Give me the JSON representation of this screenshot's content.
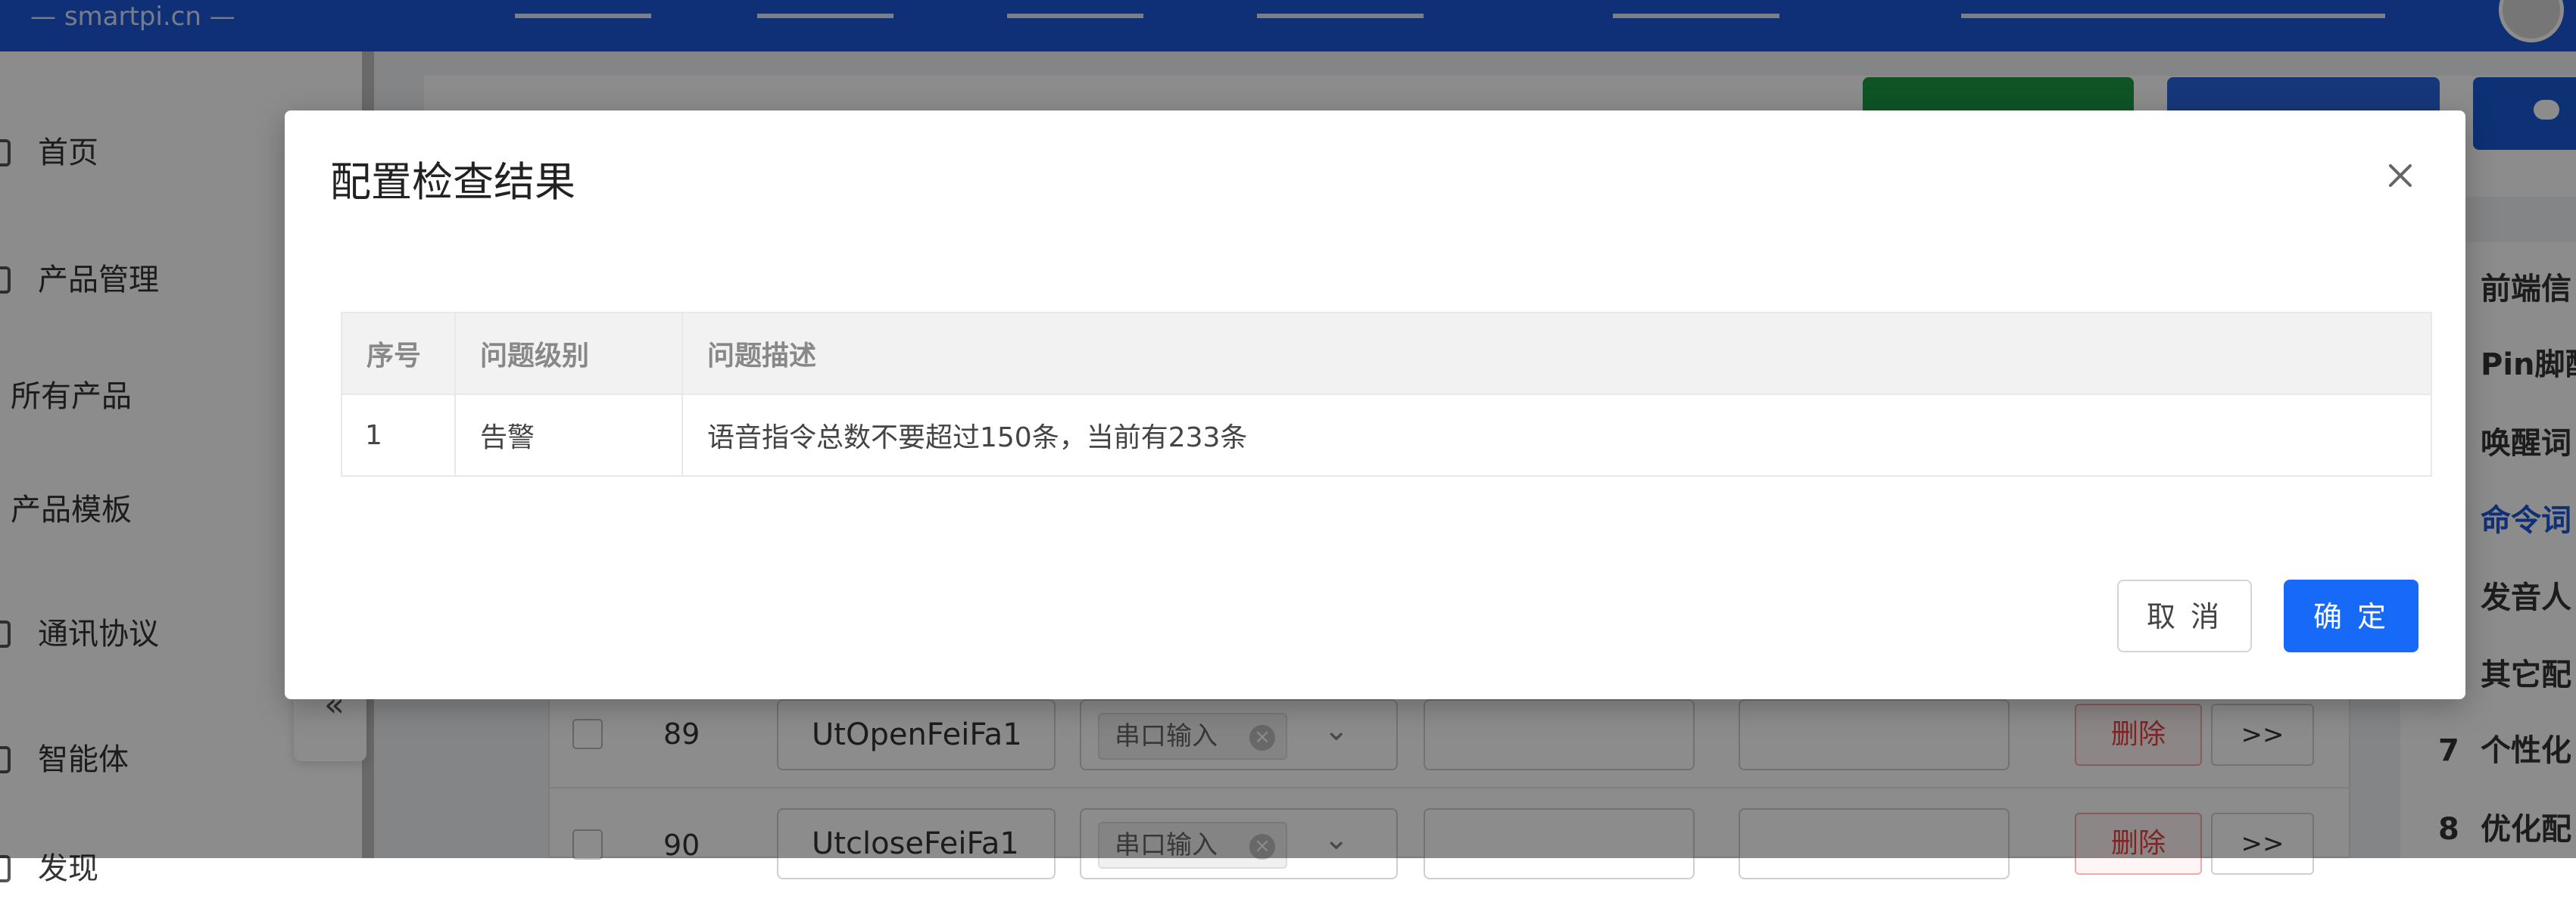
{
  "app": {
    "logo": "smartpi.cn"
  },
  "sidebar": {
    "items": [
      {
        "label": "首页"
      },
      {
        "label": "产品管理"
      },
      {
        "label": "所有产品"
      },
      {
        "label": "产品模板"
      },
      {
        "label": "通讯协议"
      },
      {
        "label": "智能体"
      },
      {
        "label": "发现"
      }
    ],
    "collapse_glyph": "«"
  },
  "right_nav": {
    "items": [
      {
        "label": "前端信"
      },
      {
        "label": "Pin脚配"
      },
      {
        "label": "唤醒词"
      },
      {
        "label": "命令词"
      },
      {
        "label": "发音人"
      },
      {
        "label": "其它配"
      },
      {
        "num": "7",
        "label": "个性化"
      },
      {
        "num": "8",
        "label": "优化配"
      }
    ]
  },
  "bg_table": {
    "rows": [
      {
        "num": "89",
        "command": "UtOpenFeiFa1",
        "tag": "串口输入",
        "delete": "删除",
        "more": ">>"
      },
      {
        "num": "90",
        "command": "UtcloseFeiFa1",
        "tag": "串口输入",
        "delete": "删除",
        "more": ">>"
      }
    ]
  },
  "modal": {
    "title": "配置检查结果",
    "close_glyph": "×",
    "table": {
      "headers": [
        "序号",
        "问题级别",
        "问题描述"
      ],
      "rows": [
        [
          "1",
          "告警",
          "语音指令总数不要超过150条，当前有233条"
        ]
      ]
    },
    "cancel_label": "取 消",
    "ok_label": "确 定"
  }
}
